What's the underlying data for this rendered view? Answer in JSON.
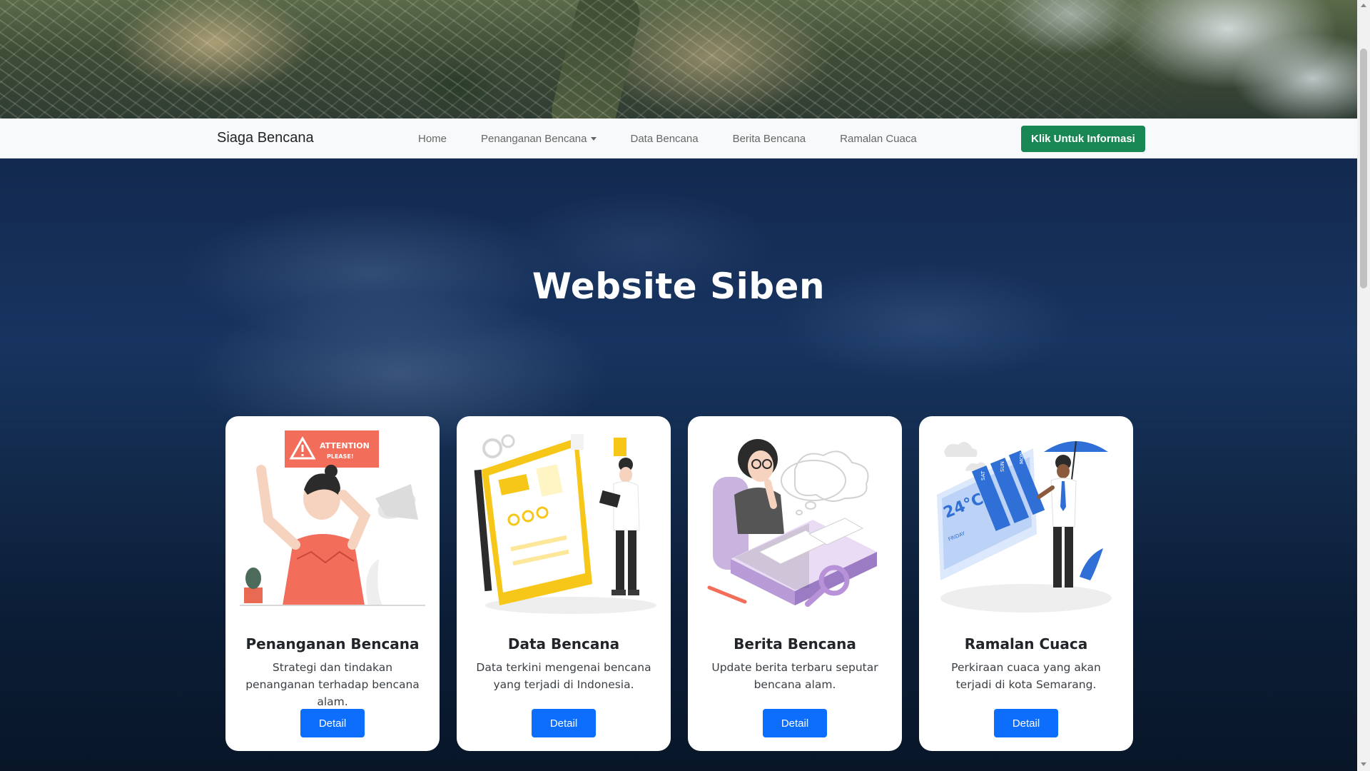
{
  "brand": "Siaga Bencana",
  "nav": {
    "items": [
      {
        "label": "Home"
      },
      {
        "label": "Penanganan Bencana",
        "dropdown": true
      },
      {
        "label": "Data Bencana"
      },
      {
        "label": "Berita Bencana"
      },
      {
        "label": "Ramalan Cuaca"
      }
    ],
    "cta_label": "Klik Untuk Informasi"
  },
  "hero": {
    "title": "Website Siben"
  },
  "cards": [
    {
      "title": "Penanganan Bencana",
      "text": "Strategi dan tindakan penanganan terhadap bencana alam.",
      "button": "Detail",
      "illustration": "attention-woman-illustration",
      "illustration_text": [
        "ATTENTION",
        "PLEASE!"
      ]
    },
    {
      "title": "Data Bencana",
      "text": "Data terkini mengenai bencana yang terjadi di Indonesia.",
      "button": "Detail",
      "illustration": "data-dashboard-illustration"
    },
    {
      "title": "Berita Bencana",
      "text": "Update berita terbaru seputar bencana alam.",
      "button": "Detail",
      "illustration": "news-reading-illustration"
    },
    {
      "title": "Ramalan Cuaca",
      "text": "Perkiraan cuaca yang akan terjadi di kota Semarang.",
      "button": "Detail",
      "illustration": "weather-forecast-illustration",
      "illustration_text": [
        "24°C",
        "SAT",
        "SUN",
        "MON",
        "FRIDAY"
      ]
    }
  ],
  "colors": {
    "navbar_bg": "#f8f9fa",
    "cta_green": "#198754",
    "detail_blue": "#0d6efd",
    "hero_navy": "#13294f",
    "accent_coral": "#f26e5b",
    "accent_yellow": "#f6c619",
    "accent_lavender": "#c9b4e0",
    "accent_blue": "#2f6fd6"
  }
}
